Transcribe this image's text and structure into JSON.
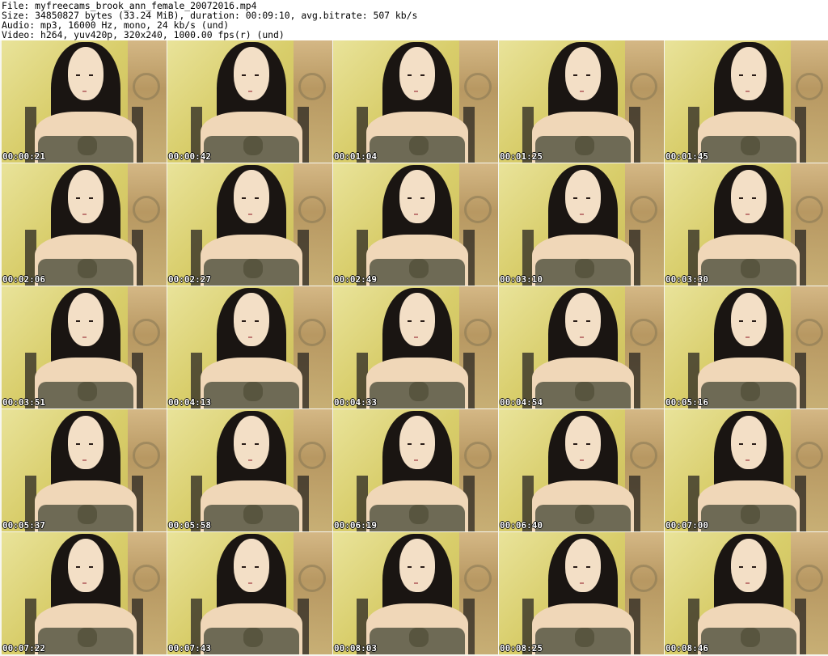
{
  "header": {
    "file": "File: myfreecams_brook_ann_female_20072016.mp4",
    "size": "Size: 34850827 bytes (33.24 MiB), duration: 00:09:10, avg.bitrate: 507 kb/s",
    "audio": "Audio: mp3, 16000 Hz, mono, 24 kb/s (und)",
    "video": "Video: h264, yuv420p, 320x240, 1000.00 fps(r) (und)"
  },
  "thumbnails": [
    "00:00:21",
    "00:00:42",
    "00:01:04",
    "00:01:25",
    "00:01:45",
    "00:02:06",
    "00:02:27",
    "00:02:49",
    "00:03:10",
    "00:03:30",
    "00:03:51",
    "00:04:13",
    "00:04:33",
    "00:04:54",
    "00:05:16",
    "00:05:37",
    "00:05:58",
    "00:06:19",
    "00:06:40",
    "00:07:00",
    "00:07:22",
    "00:07:43",
    "00:08:03",
    "00:08:25",
    "00:08:46"
  ]
}
